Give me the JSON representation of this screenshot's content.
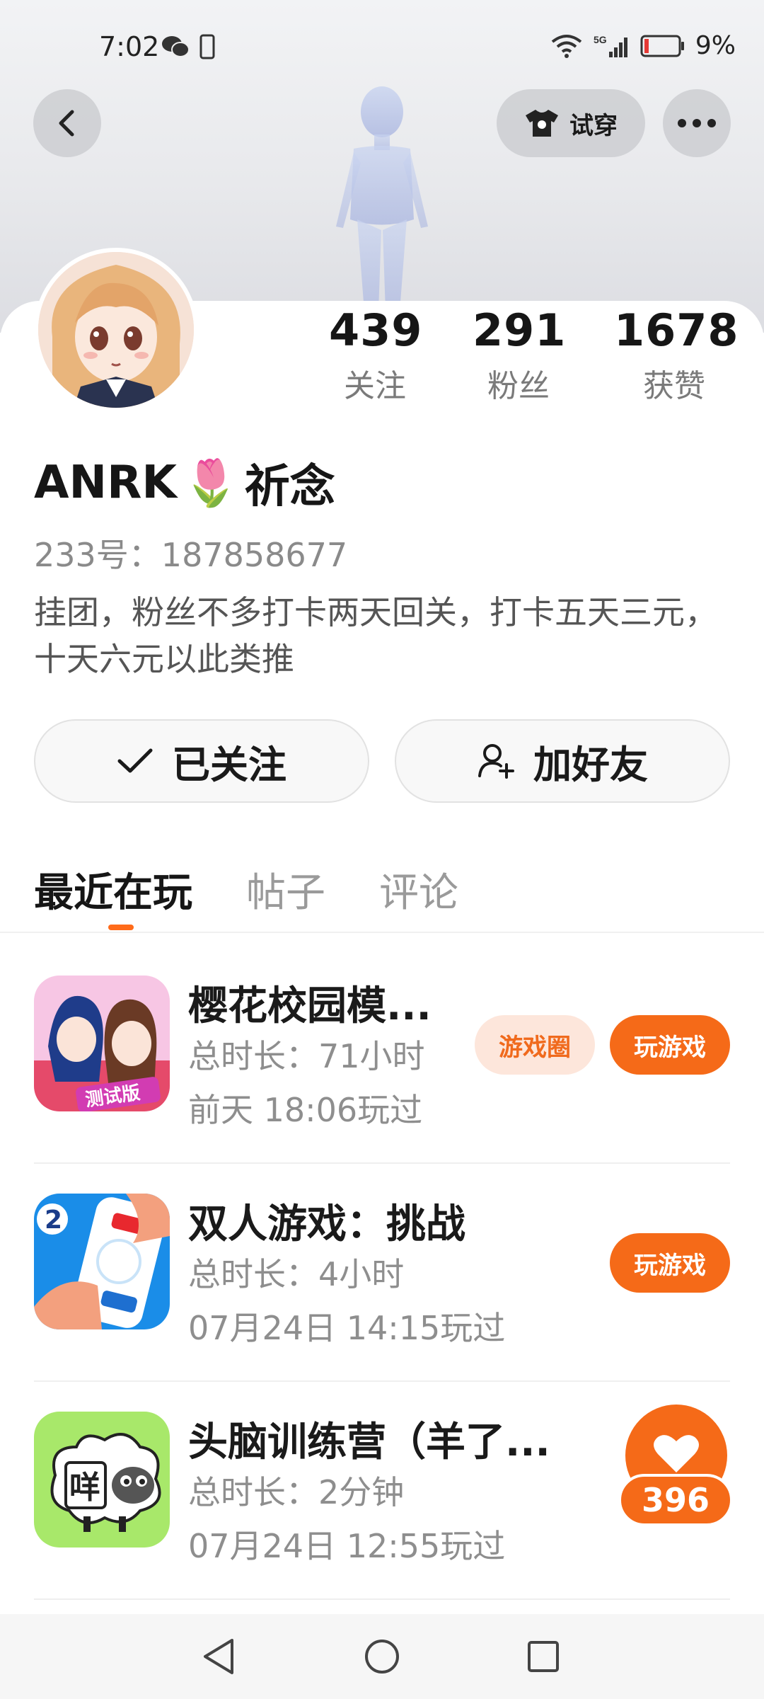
{
  "status_bar": {
    "time": "7:02",
    "battery": "9%",
    "network": "5G",
    "icons": [
      "wechat-icon",
      "phone-icon",
      "wifi-icon",
      "signal-icon",
      "battery-icon"
    ]
  },
  "header": {
    "tryon_label": "试穿",
    "icons": [
      "back-arrow-icon",
      "tshirt-icon",
      "more-dots-icon"
    ]
  },
  "profile": {
    "name": "ANRK",
    "name_emoji": "🌷",
    "name_suffix": "祈念",
    "id_line": "233号：187858677",
    "bio": "挂团，粉丝不多打卡两天回关，打卡五天三元，十天六元以此类推",
    "stats": [
      {
        "value": "439",
        "label": "关注"
      },
      {
        "value": "291",
        "label": "粉丝"
      },
      {
        "value": "1678",
        "label": "获赞"
      }
    ]
  },
  "actions": {
    "following_label": "已关注",
    "add_friend_label": "加好友"
  },
  "tabs": [
    {
      "label": "最近在玩",
      "active": true
    },
    {
      "label": "帖子",
      "active": false
    },
    {
      "label": "评论",
      "active": false
    }
  ],
  "games": [
    {
      "title": "樱花校园模...",
      "duration": "总时长：71小时",
      "last_played": "前天 18:06玩过",
      "circle_label": "游戏圈",
      "play_label": "玩游戏"
    },
    {
      "title": "双人游戏：挑战",
      "duration": "总时长：4小时",
      "last_played": "07月24日 14:15玩过",
      "play_label": "玩游戏"
    },
    {
      "title": "头脑训练营（羊了...",
      "duration": "总时长：2分钟",
      "last_played": "07月24日 12:55玩过"
    }
  ],
  "like_bubble": {
    "count": "396"
  },
  "colors": {
    "accent": "#f56a18",
    "accent_light": "#fde6db",
    "text_primary": "#161616",
    "text_secondary": "#8e8e8e"
  }
}
